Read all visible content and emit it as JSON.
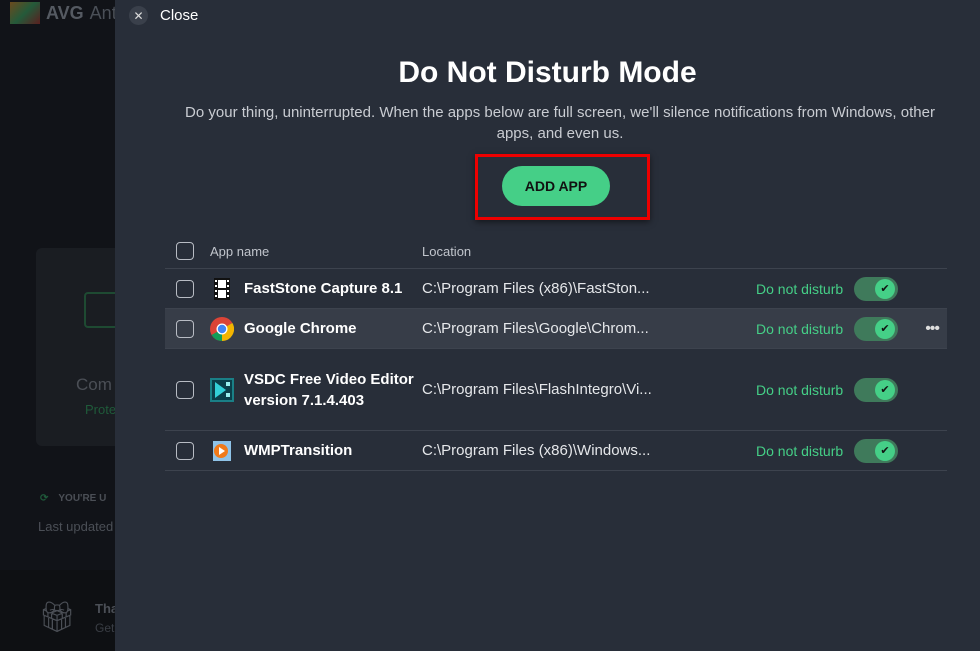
{
  "background": {
    "brand": "AVG",
    "title_fragment": "Ant",
    "card_title": "Com",
    "card_status": "Prote",
    "update_status": "YOU'RE U",
    "last_updated": "Last updated",
    "promo_title": "Tha",
    "promo_sub": "Get"
  },
  "panel": {
    "close_label": "Close",
    "title": "Do Not Disturb Mode",
    "description": "Do your thing, uninterrupted. When the apps below are full screen, we'll silence notifications from Windows, other apps, and even us.",
    "add_app_label": "ADD APP",
    "columns": {
      "app_name": "App name",
      "location": "Location"
    },
    "apps": [
      {
        "name": "FastStone Capture 8.1",
        "location": "C:\\Program Files (x86)\\FastSton...",
        "status": "Do not disturb",
        "enabled": true,
        "icon": "film-icon"
      },
      {
        "name": "Google Chrome",
        "location": "C:\\Program Files\\Google\\Chrom...",
        "status": "Do not disturb",
        "enabled": true,
        "icon": "chrome-icon"
      },
      {
        "name": "VSDC Free Video Editor version 7.1.4.403",
        "location": "C:\\Program Files\\FlashIntegro\\Vi...",
        "status": "Do not disturb",
        "enabled": true,
        "icon": "vsdc-icon"
      },
      {
        "name": "WMPTransition",
        "location": "C:\\Program Files (x86)\\Windows...",
        "status": "Do not disturb",
        "enabled": true,
        "icon": "media-player-icon"
      }
    ]
  },
  "colors": {
    "accent": "#45cf87",
    "panel_bg": "#282e39",
    "highlight": "#ee0000"
  }
}
